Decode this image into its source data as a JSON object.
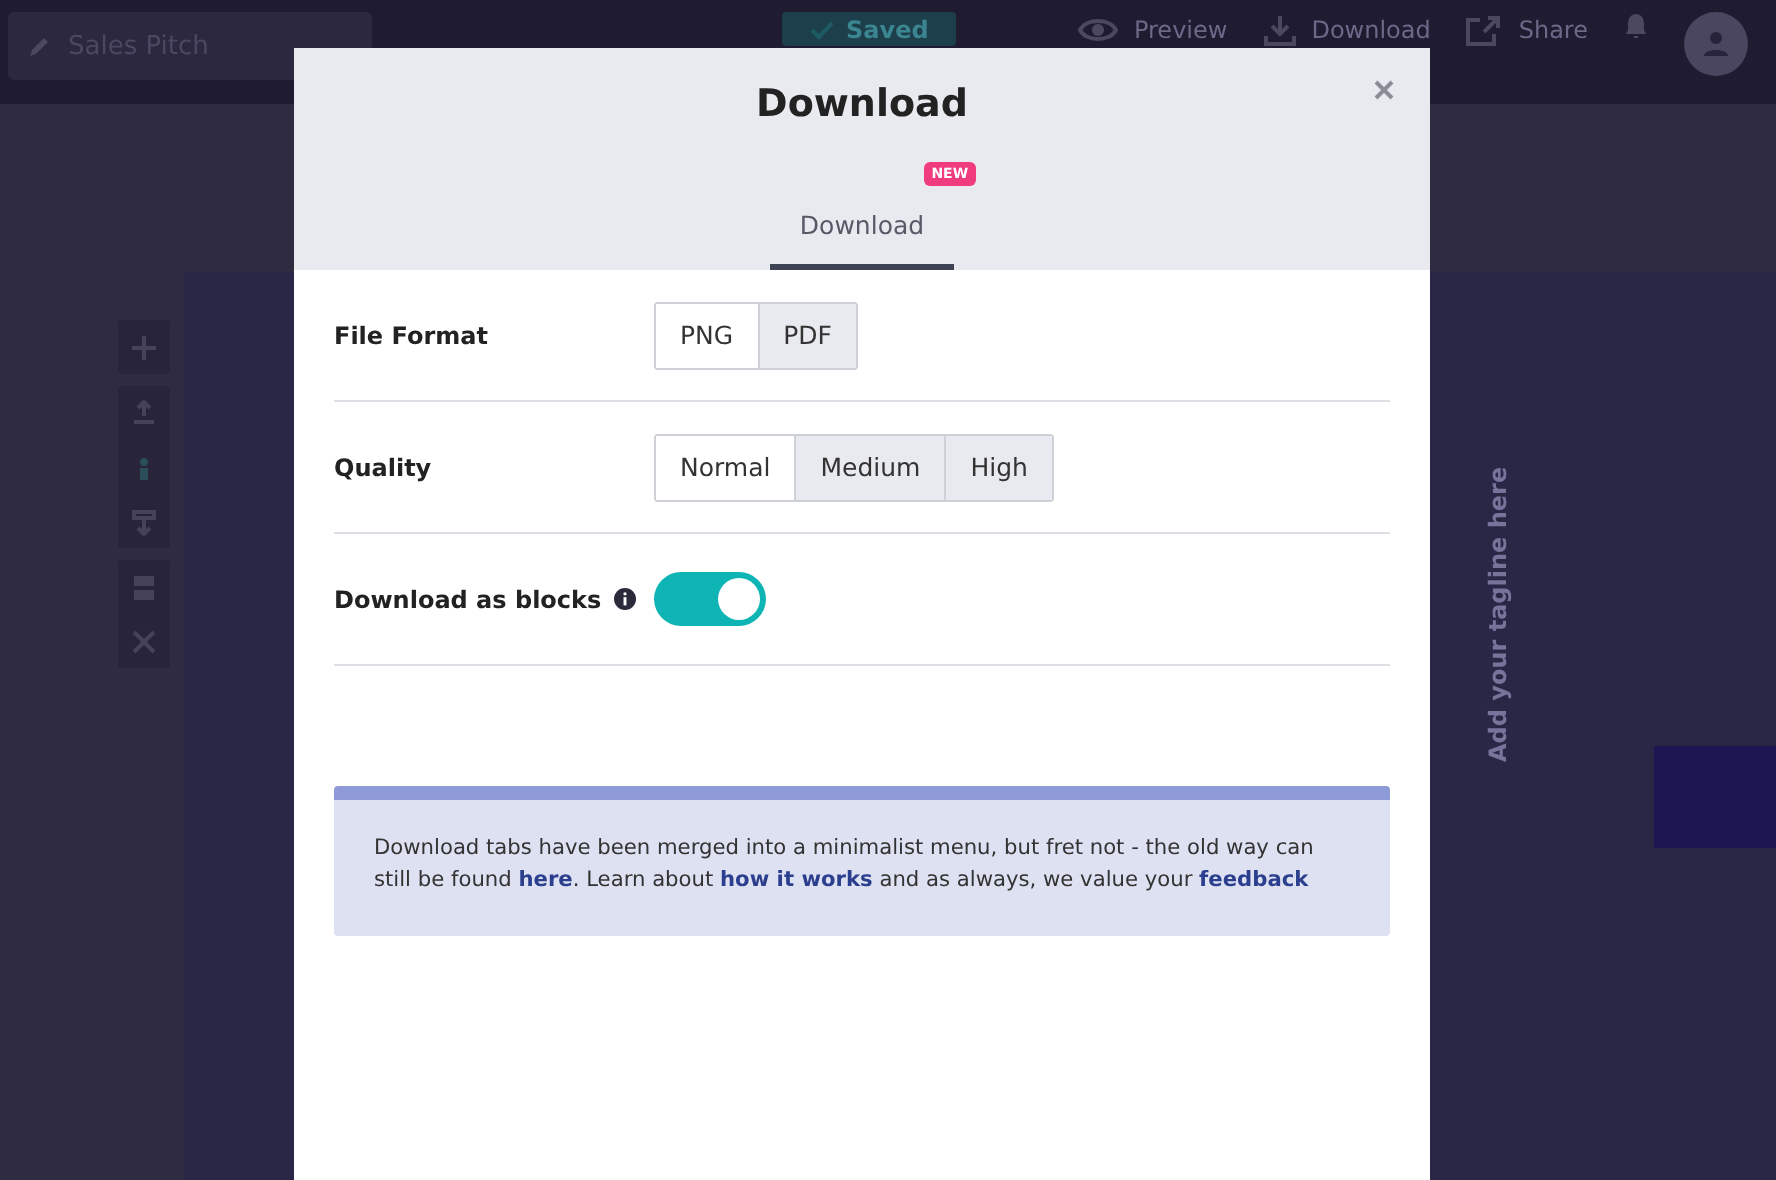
{
  "app_bar": {
    "document_title": "Sales Pitch",
    "saved_label": "Saved",
    "actions": [
      {
        "kind": "preview",
        "label": "Preview"
      },
      {
        "kind": "download",
        "label": "Download"
      },
      {
        "kind": "share",
        "label": "Share"
      }
    ]
  },
  "canvas": {
    "tagline": "Add your tagline here"
  },
  "dialog": {
    "title": "Download",
    "tabs": [
      {
        "label": "Download",
        "badge": "NEW",
        "selected": true
      }
    ],
    "rows": [
      {
        "kind": "segmented",
        "label": "File Format",
        "options": [
          {
            "label": "PNG",
            "selected": true
          },
          {
            "label": "PDF",
            "selected": false
          }
        ]
      },
      {
        "kind": "segmented",
        "label": "Quality",
        "options": [
          {
            "label": "Normal",
            "selected": true
          },
          {
            "label": "Medium",
            "selected": false
          },
          {
            "label": "High",
            "selected": false
          }
        ]
      },
      {
        "kind": "toggle",
        "label": "Download as blocks",
        "info": true,
        "on": true
      }
    ],
    "notice": [
      {
        "text": "Download tabs have been merged into a minimalist menu, but fret not - the old way can still be found ",
        "link": false
      },
      {
        "text": "here",
        "link": true
      },
      {
        "text": ". Learn about ",
        "link": false
      },
      {
        "text": "how it works",
        "link": true
      },
      {
        "text": " and as always, we value your ",
        "link": false
      },
      {
        "text": "feedback",
        "link": true
      }
    ]
  }
}
